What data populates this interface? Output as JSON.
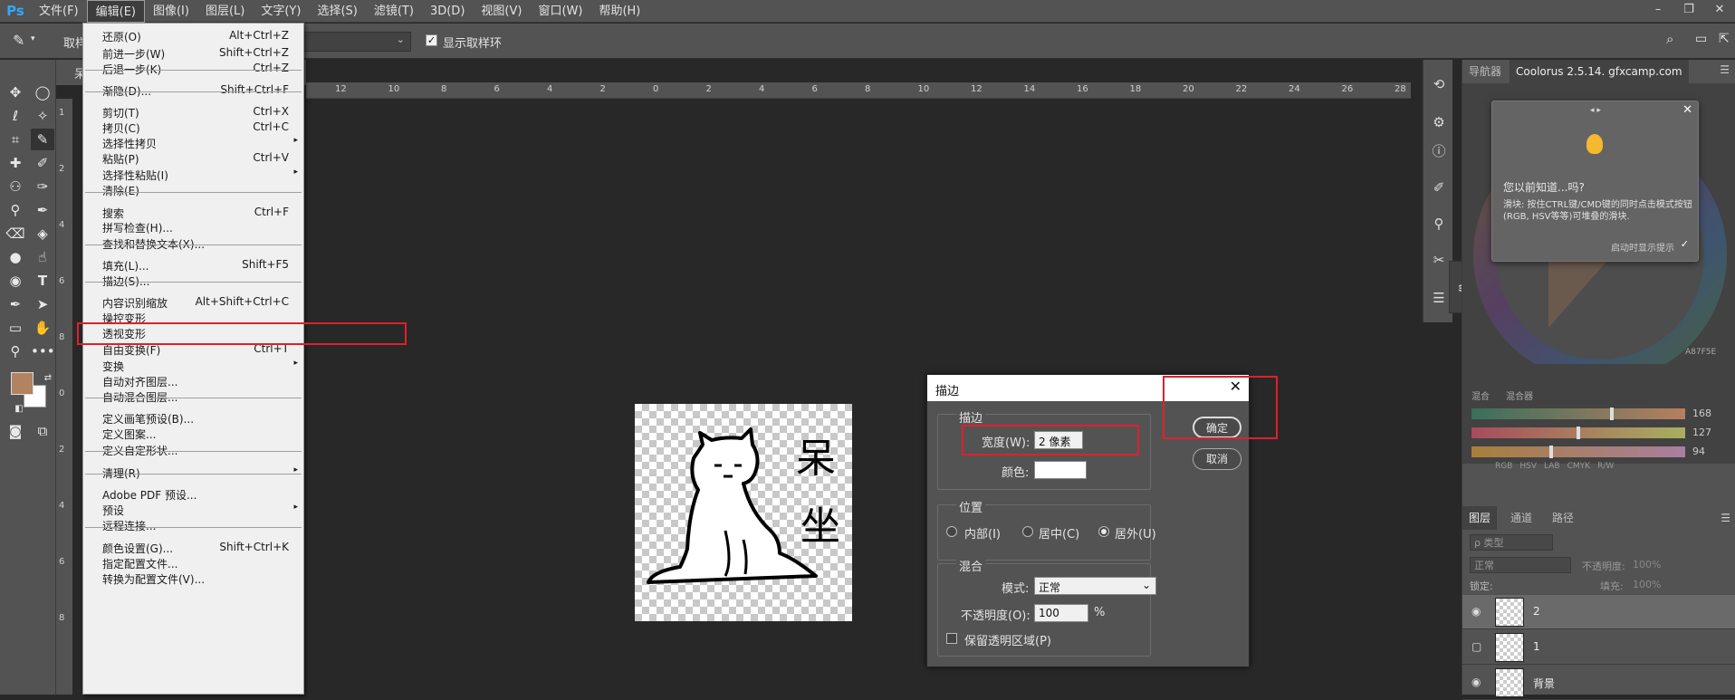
{
  "app": {
    "logo": "Ps"
  },
  "menubar": {
    "items": [
      "文件(F)",
      "编辑(E)",
      "图像(I)",
      "图层(L)",
      "文字(Y)",
      "选择(S)",
      "滤镜(T)",
      "3D(D)",
      "视图(V)",
      "窗口(W)",
      "帮助(H)"
    ],
    "active": "编辑(E)",
    "window_controls": [
      "–",
      "❐",
      "✕"
    ]
  },
  "options_bar": {
    "tool_label": "取样",
    "show_ring_label": "显示取样环",
    "show_ring_checked": true
  },
  "edit_menu": {
    "items": [
      {
        "label": "还原(O)",
        "shortcut": "Alt+Ctrl+Z"
      },
      {
        "label": "前进一步(W)",
        "shortcut": "Shift+Ctrl+Z"
      },
      {
        "label": "后退一步(K)",
        "shortcut": "Ctrl+Z"
      },
      {
        "label": "渐隐(D)...",
        "shortcut": "Shift+Ctrl+F"
      },
      {
        "label": "剪切(T)",
        "shortcut": "Ctrl+X"
      },
      {
        "label": "拷贝(C)",
        "shortcut": "Ctrl+C"
      },
      {
        "label": "选择性拷贝",
        "shortcut": "",
        "submenu": true
      },
      {
        "label": "粘贴(P)",
        "shortcut": "Ctrl+V"
      },
      {
        "label": "选择性粘贴(I)",
        "shortcut": "",
        "submenu": true
      },
      {
        "label": "清除(E)",
        "shortcut": ""
      },
      {
        "label": "搜索",
        "shortcut": "Ctrl+F"
      },
      {
        "label": "拼写检查(H)...",
        "shortcut": ""
      },
      {
        "label": "查找和替换文本(X)...",
        "shortcut": ""
      },
      {
        "label": "填充(L)...",
        "shortcut": "Shift+F5"
      },
      {
        "label": "描边(S)...",
        "shortcut": ""
      },
      {
        "label": "内容识别缩放",
        "shortcut": "Alt+Shift+Ctrl+C"
      },
      {
        "label": "操控变形",
        "shortcut": ""
      },
      {
        "label": "透视变形",
        "shortcut": ""
      },
      {
        "label": "自由变换(F)",
        "shortcut": "Ctrl+T"
      },
      {
        "label": "变换",
        "shortcut": "",
        "submenu": true
      },
      {
        "label": "自动对齐图层...",
        "shortcut": ""
      },
      {
        "label": "自动混合图层...",
        "shortcut": ""
      },
      {
        "label": "定义画笔预设(B)...",
        "shortcut": ""
      },
      {
        "label": "定义图案...",
        "shortcut": ""
      },
      {
        "label": "定义自定形状...",
        "shortcut": ""
      },
      {
        "label": "清理(R)",
        "shortcut": "",
        "submenu": true
      },
      {
        "label": "Adobe PDF 预设...",
        "shortcut": ""
      },
      {
        "label": "预设",
        "shortcut": "",
        "submenu": true
      },
      {
        "label": "远程连接...",
        "shortcut": ""
      },
      {
        "label": "颜色设置(G)...",
        "shortcut": "Shift+Ctrl+K"
      },
      {
        "label": "指定配置文件...",
        "shortcut": ""
      },
      {
        "label": "转换为配置文件(V)...",
        "shortcut": ""
      }
    ]
  },
  "rulers": {
    "top": [
      "12",
      "10",
      "8",
      "6",
      "4",
      "2",
      "0",
      "2",
      "4",
      "6",
      "8",
      "10",
      "12",
      "14",
      "16",
      "18",
      "20",
      "22",
      "24",
      "26",
      "28"
    ],
    "left": [
      "1",
      "2",
      "4",
      "6",
      "8",
      "0",
      "2",
      "4",
      "6",
      "8"
    ]
  },
  "artwork": {
    "chars": [
      "呆",
      "坐"
    ]
  },
  "stroke_dialog": {
    "title": "描边",
    "stroke_group": "描边",
    "width_label": "宽度(W):",
    "width_value": "2 像素",
    "color_label": "颜色:",
    "color_value": "#ffffff",
    "position_group": "位置",
    "positions": [
      "内部(I)",
      "居中(C)",
      "居外(U)"
    ],
    "selected_position": "居外(U)",
    "blend_group": "混合",
    "mode_label": "模式:",
    "mode_value": "正常",
    "opacity_label": "不透明度(O):",
    "opacity_value": "100",
    "opacity_unit": "%",
    "preserve_label": "保留透明区域(P)",
    "preserve_checked": false,
    "ok_label": "确定",
    "cancel_label": "取消"
  },
  "right_panel": {
    "tabs": [
      "导航器",
      "Coolorus 2.5.14. gfxcamp.com"
    ],
    "tip": {
      "title": "您以前知道...吗?",
      "body": "滑块: 按住CTRL键/CMD键的同时点击模式按钮(RGB, HSV等等)可堆叠的滑块.",
      "footer": "启动时显示提示",
      "nav": "◂ ▸"
    },
    "hex": "A87F5E",
    "mix_tabs": [
      "混合",
      "混合器"
    ],
    "sliders": [
      {
        "value": "168",
        "fraction": 0.66
      },
      {
        "value": "127",
        "fraction": 0.5
      },
      {
        "value": "94",
        "fraction": 0.37
      }
    ],
    "modes": [
      "RGB",
      "HSV",
      "LAB",
      "CMYK",
      "R/W"
    ]
  },
  "layers_panel": {
    "tabs": [
      "图层",
      "通道",
      "路径"
    ],
    "filter_label": "ρ 类型",
    "blend_mode": "正常",
    "opacity_label": "不透明度:",
    "opacity_value": "100%",
    "lock_label": "锁定:",
    "fill_label": "填充:",
    "fill_value": "100%",
    "layers": [
      {
        "name": "2",
        "visible": true,
        "selected": true
      },
      {
        "name": "1",
        "visible": false,
        "selected": false
      },
      {
        "name": "背景",
        "visible": true,
        "selected": false
      }
    ]
  },
  "colors": {
    "foreground": "#b38261",
    "background": "#ffffff",
    "highlight": "#e0202a"
  }
}
